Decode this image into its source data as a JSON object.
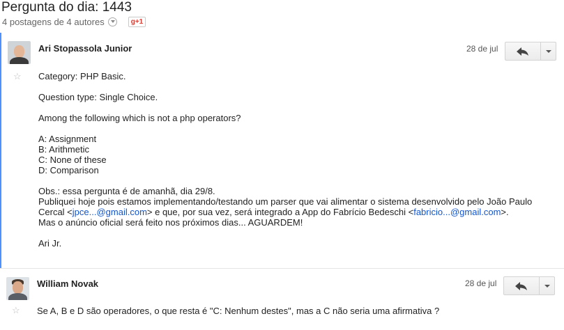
{
  "topic": {
    "title": "Pergunta do dia: 1443",
    "meta": "4 postagens de 4 autores",
    "gplus_label": "g+1"
  },
  "posts": [
    {
      "author": "Ari Stopassola Junior",
      "date": "28 de jul",
      "lines": {
        "category": "Category: PHP Basic.",
        "qtype": "Question type: Single Choice.",
        "question": "Among the following which is not a php operators?",
        "opt_a": "A: Assignment",
        "opt_b": "B: Arithmetic",
        "opt_c": "C: None of these",
        "opt_d": "D: Comparison",
        "obs": "Obs.: essa pergunta é de amanhã, dia 29/8.",
        "pub1": "Publiquei hoje pois estamos implementando/testando um parser que vai alimentar o sistema desenvolvido pelo João Paulo",
        "pub2_a": "Cercal <",
        "email1": "jpce...@gmail.com",
        "pub2_b": "> e que, por sua vez, será integrado a App do Fabrício Bedeschi <",
        "email2": "fabricio...@gmail.com",
        "pub2_c": ">.",
        "announce": "Mas o anúncio oficial será feito nos próximos dias... AGUARDEM!",
        "signature": "Ari Jr."
      }
    },
    {
      "author": "William Novak",
      "date": "28 de jul",
      "lines": {
        "text": "Se A, B e D são operadores, o que resta é \"C: Nenhum destes\", mas a C não seria uma afirmativa ?"
      }
    }
  ],
  "icons": {
    "reply": "reply-arrow-icon",
    "more": "chevron-down-icon",
    "star": "star-icon",
    "meta": "chevron-circle-down-icon"
  },
  "colors": {
    "link": "#1155cc",
    "selected_border": "#4d90fe",
    "gplus": "#d73d32"
  }
}
